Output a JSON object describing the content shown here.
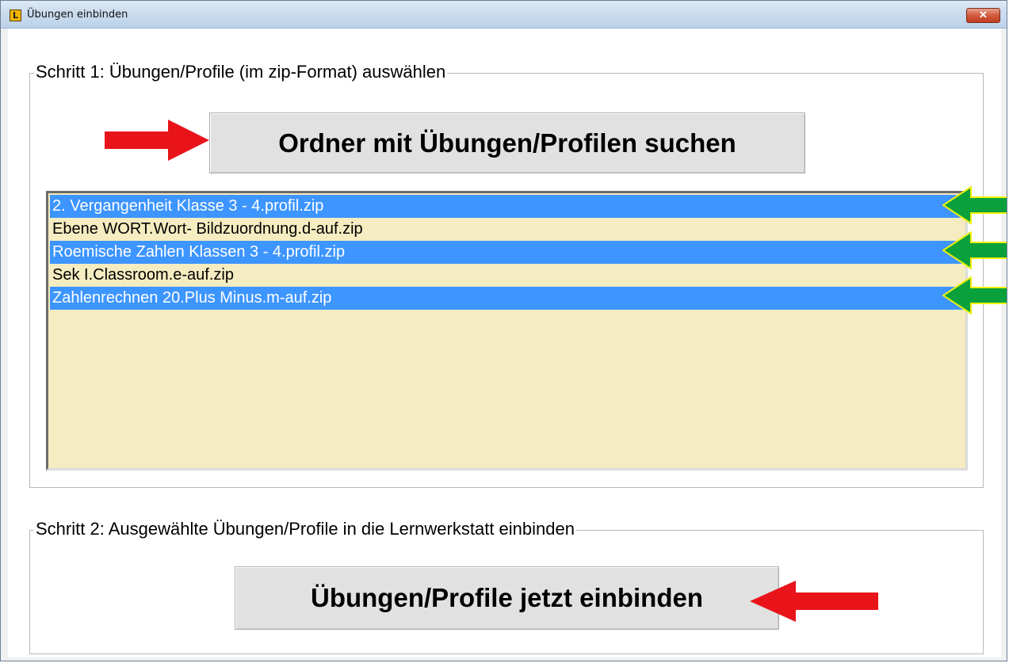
{
  "window": {
    "title": "Übungen einbinden",
    "app_icon_letter": "L",
    "close_symbol": "✕"
  },
  "step1": {
    "legend": "Schritt 1: Übungen/Profile (im zip-Format) auswählen",
    "button_label": "Ordner mit Übungen/Profilen suchen",
    "files": [
      {
        "name": "2. Vergangenheit Klasse 3 - 4.profil.zip",
        "selected": true
      },
      {
        "name": "Ebene WORT.Wort- Bildzuordnung.d-auf.zip",
        "selected": false
      },
      {
        "name": "Roemische Zahlen Klassen 3 - 4.profil.zip",
        "selected": true
      },
      {
        "name": "Sek I.Classroom.e-auf.zip",
        "selected": false
      },
      {
        "name": "Zahlenrechnen 20.Plus Minus.m-auf.zip",
        "selected": true
      }
    ]
  },
  "step2": {
    "legend": "Schritt 2: Ausgewählte Übungen/Profile in die Lernwerkstatt einbinden",
    "button_label": "Übungen/Profile jetzt einbinden"
  },
  "colors": {
    "selection": "#3d95ff",
    "list_background": "#f5ecc1",
    "annotation_red_arrow": "#e8141a",
    "annotation_green_arrow": "#0aa03c"
  },
  "icons": {
    "close": "close-icon",
    "app": "app-logo-icon"
  }
}
